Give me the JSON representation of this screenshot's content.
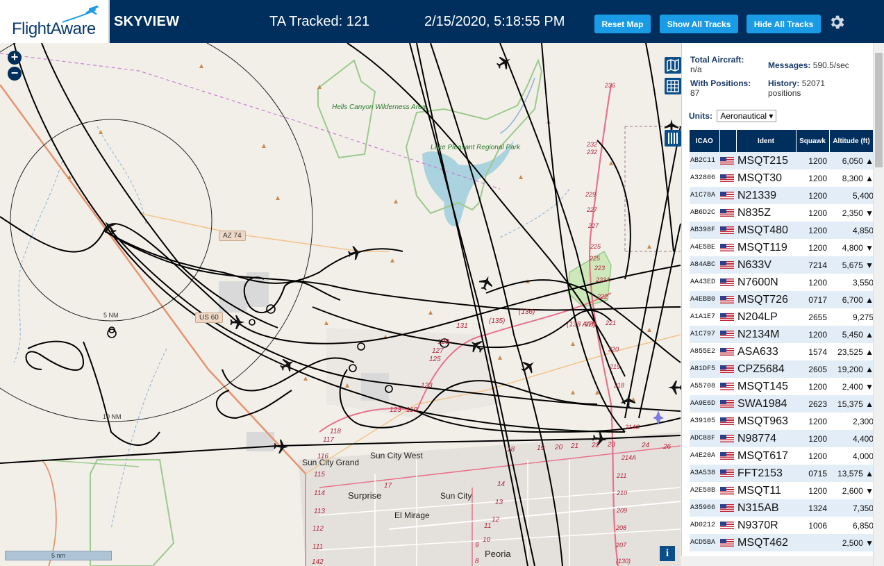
{
  "header": {
    "logo": "FlightAware",
    "app_title": "SKYVIEW",
    "tracked": "TA Tracked: 121",
    "datetime": "2/15/2020, 5:18:55 PM",
    "buttons": {
      "reset": "Reset Map",
      "show": "Show All Tracks",
      "hide": "Hide All Tracks"
    },
    "settings_icon": "gear-icon",
    "brand_color": "#002f5d",
    "button_color": "#1a9be6"
  },
  "map": {
    "labels": {
      "hells_canyon": "Hells Canyon Wilderness Area",
      "lake_pleasant": "Lake Pleasant Regional Park",
      "az74": "AZ 74",
      "us60": "US 60",
      "nm5": "5 NM",
      "nm10": "10 NM",
      "sun_city_grand": "Sun City Grand",
      "sun_city_west": "Sun City West",
      "sun_city": "Sun City",
      "surprise": "Surprise",
      "el_mirage": "El Mirage",
      "peoria": "Peoria",
      "scale": "5 nm"
    },
    "route_numbers": [
      "236",
      "232",
      "232",
      "229",
      "227",
      "227",
      "225",
      "225",
      "223",
      "223A",
      "222",
      "221",
      "220",
      "219",
      "218",
      "217",
      "216",
      "215",
      "214",
      "214C",
      "214A",
      "212",
      "211",
      "210",
      "209",
      "208",
      "207",
      "(130)",
      "131",
      "(135)",
      "(136)",
      "(138 A/B)",
      "129",
      "128",
      "127",
      "125",
      "123",
      "123",
      "119",
      "118",
      "117",
      "116",
      "115",
      "114",
      "113",
      "112",
      "111",
      "142",
      "17",
      "18",
      "19",
      "20",
      "21",
      "22",
      "23",
      "24",
      "26",
      "15",
      "14",
      "13",
      "12",
      "11",
      "10",
      "9",
      "8"
    ],
    "icons": [
      "zoom-in-icon",
      "zoom-out-icon",
      "map-layers-icon",
      "grid-icon",
      "columns-icon",
      "info-icon",
      "aircraft-icon"
    ]
  },
  "panel": {
    "total_aircraft_label": "Total Aircraft:",
    "total_aircraft_value": "n/a",
    "with_positions_label": "With Positions:",
    "with_positions_value": "87",
    "messages_label": "Messages:",
    "messages_value": "590.5/sec",
    "history_label": "History:",
    "history_value": "52071",
    "history_unit": "positions",
    "units_label": "Units:",
    "units_value": "Aeronautical",
    "columns": [
      "ICAO",
      "",
      "Ident",
      "Squawk",
      "Altitude (ft)"
    ],
    "rows": [
      {
        "icao": "AB2C11",
        "ident": "MSQT215",
        "squawk": "1200",
        "alt": "6,050",
        "trend": "▲"
      },
      {
        "icao": "A32806",
        "ident": "MSQT30",
        "squawk": "1200",
        "alt": "8,300",
        "trend": "▲"
      },
      {
        "icao": "A1C78A",
        "ident": "N21339",
        "squawk": "1200",
        "alt": "5,400",
        "trend": ""
      },
      {
        "icao": "AB6D2C",
        "ident": "N835Z",
        "squawk": "1200",
        "alt": "2,350",
        "trend": "▼"
      },
      {
        "icao": "AB398F",
        "ident": "MSQT480",
        "squawk": "1200",
        "alt": "4,850",
        "trend": ""
      },
      {
        "icao": "A4E5BE",
        "ident": "MSQT119",
        "squawk": "1200",
        "alt": "4,800",
        "trend": "▼"
      },
      {
        "icao": "A84ABC",
        "ident": "N633V",
        "squawk": "7214",
        "alt": "5,675",
        "trend": "▼"
      },
      {
        "icao": "AA43ED",
        "ident": "N7600N",
        "squawk": "1200",
        "alt": "3,550",
        "trend": ""
      },
      {
        "icao": "A4EBB0",
        "ident": "MSQT726",
        "squawk": "0717",
        "alt": "6,700",
        "trend": "▲"
      },
      {
        "icao": "A1A1E7",
        "ident": "N204LP",
        "squawk": "2655",
        "alt": "9,275",
        "trend": ""
      },
      {
        "icao": "A1C797",
        "ident": "N2134M",
        "squawk": "1200",
        "alt": "5,450",
        "trend": "▲"
      },
      {
        "icao": "A855E2",
        "ident": "ASA633",
        "squawk": "1574",
        "alt": "23,525",
        "trend": "▲"
      },
      {
        "icao": "A81DF5",
        "ident": "CPZ5684",
        "squawk": "2605",
        "alt": "19,200",
        "trend": "▲"
      },
      {
        "icao": "A55708",
        "ident": "MSQT145",
        "squawk": "1200",
        "alt": "2,400",
        "trend": "▼"
      },
      {
        "icao": "AA9E6D",
        "ident": "SWA1984",
        "squawk": "2623",
        "alt": "15,375",
        "trend": "▲"
      },
      {
        "icao": "A39105",
        "ident": "MSQT963",
        "squawk": "1200",
        "alt": "2,300",
        "trend": ""
      },
      {
        "icao": "ADC88F",
        "ident": "N98774",
        "squawk": "1200",
        "alt": "4,400",
        "trend": ""
      },
      {
        "icao": "A4E20A",
        "ident": "MSQT617",
        "squawk": "1200",
        "alt": "4,000",
        "trend": ""
      },
      {
        "icao": "A3A538",
        "ident": "FFT2153",
        "squawk": "0715",
        "alt": "13,575",
        "trend": "▲"
      },
      {
        "icao": "A2E58B",
        "ident": "MSQT11",
        "squawk": "1200",
        "alt": "2,600",
        "trend": "▼"
      },
      {
        "icao": "A35966",
        "ident": "N315AB",
        "squawk": "1324",
        "alt": "7,350",
        "trend": ""
      },
      {
        "icao": "AD0212",
        "ident": "N9370R",
        "squawk": "1006",
        "alt": "6,850",
        "trend": ""
      },
      {
        "icao": "ACD5BA",
        "ident": "MSQT462",
        "squawk": "",
        "alt": "2,500",
        "trend": "▼"
      }
    ]
  }
}
